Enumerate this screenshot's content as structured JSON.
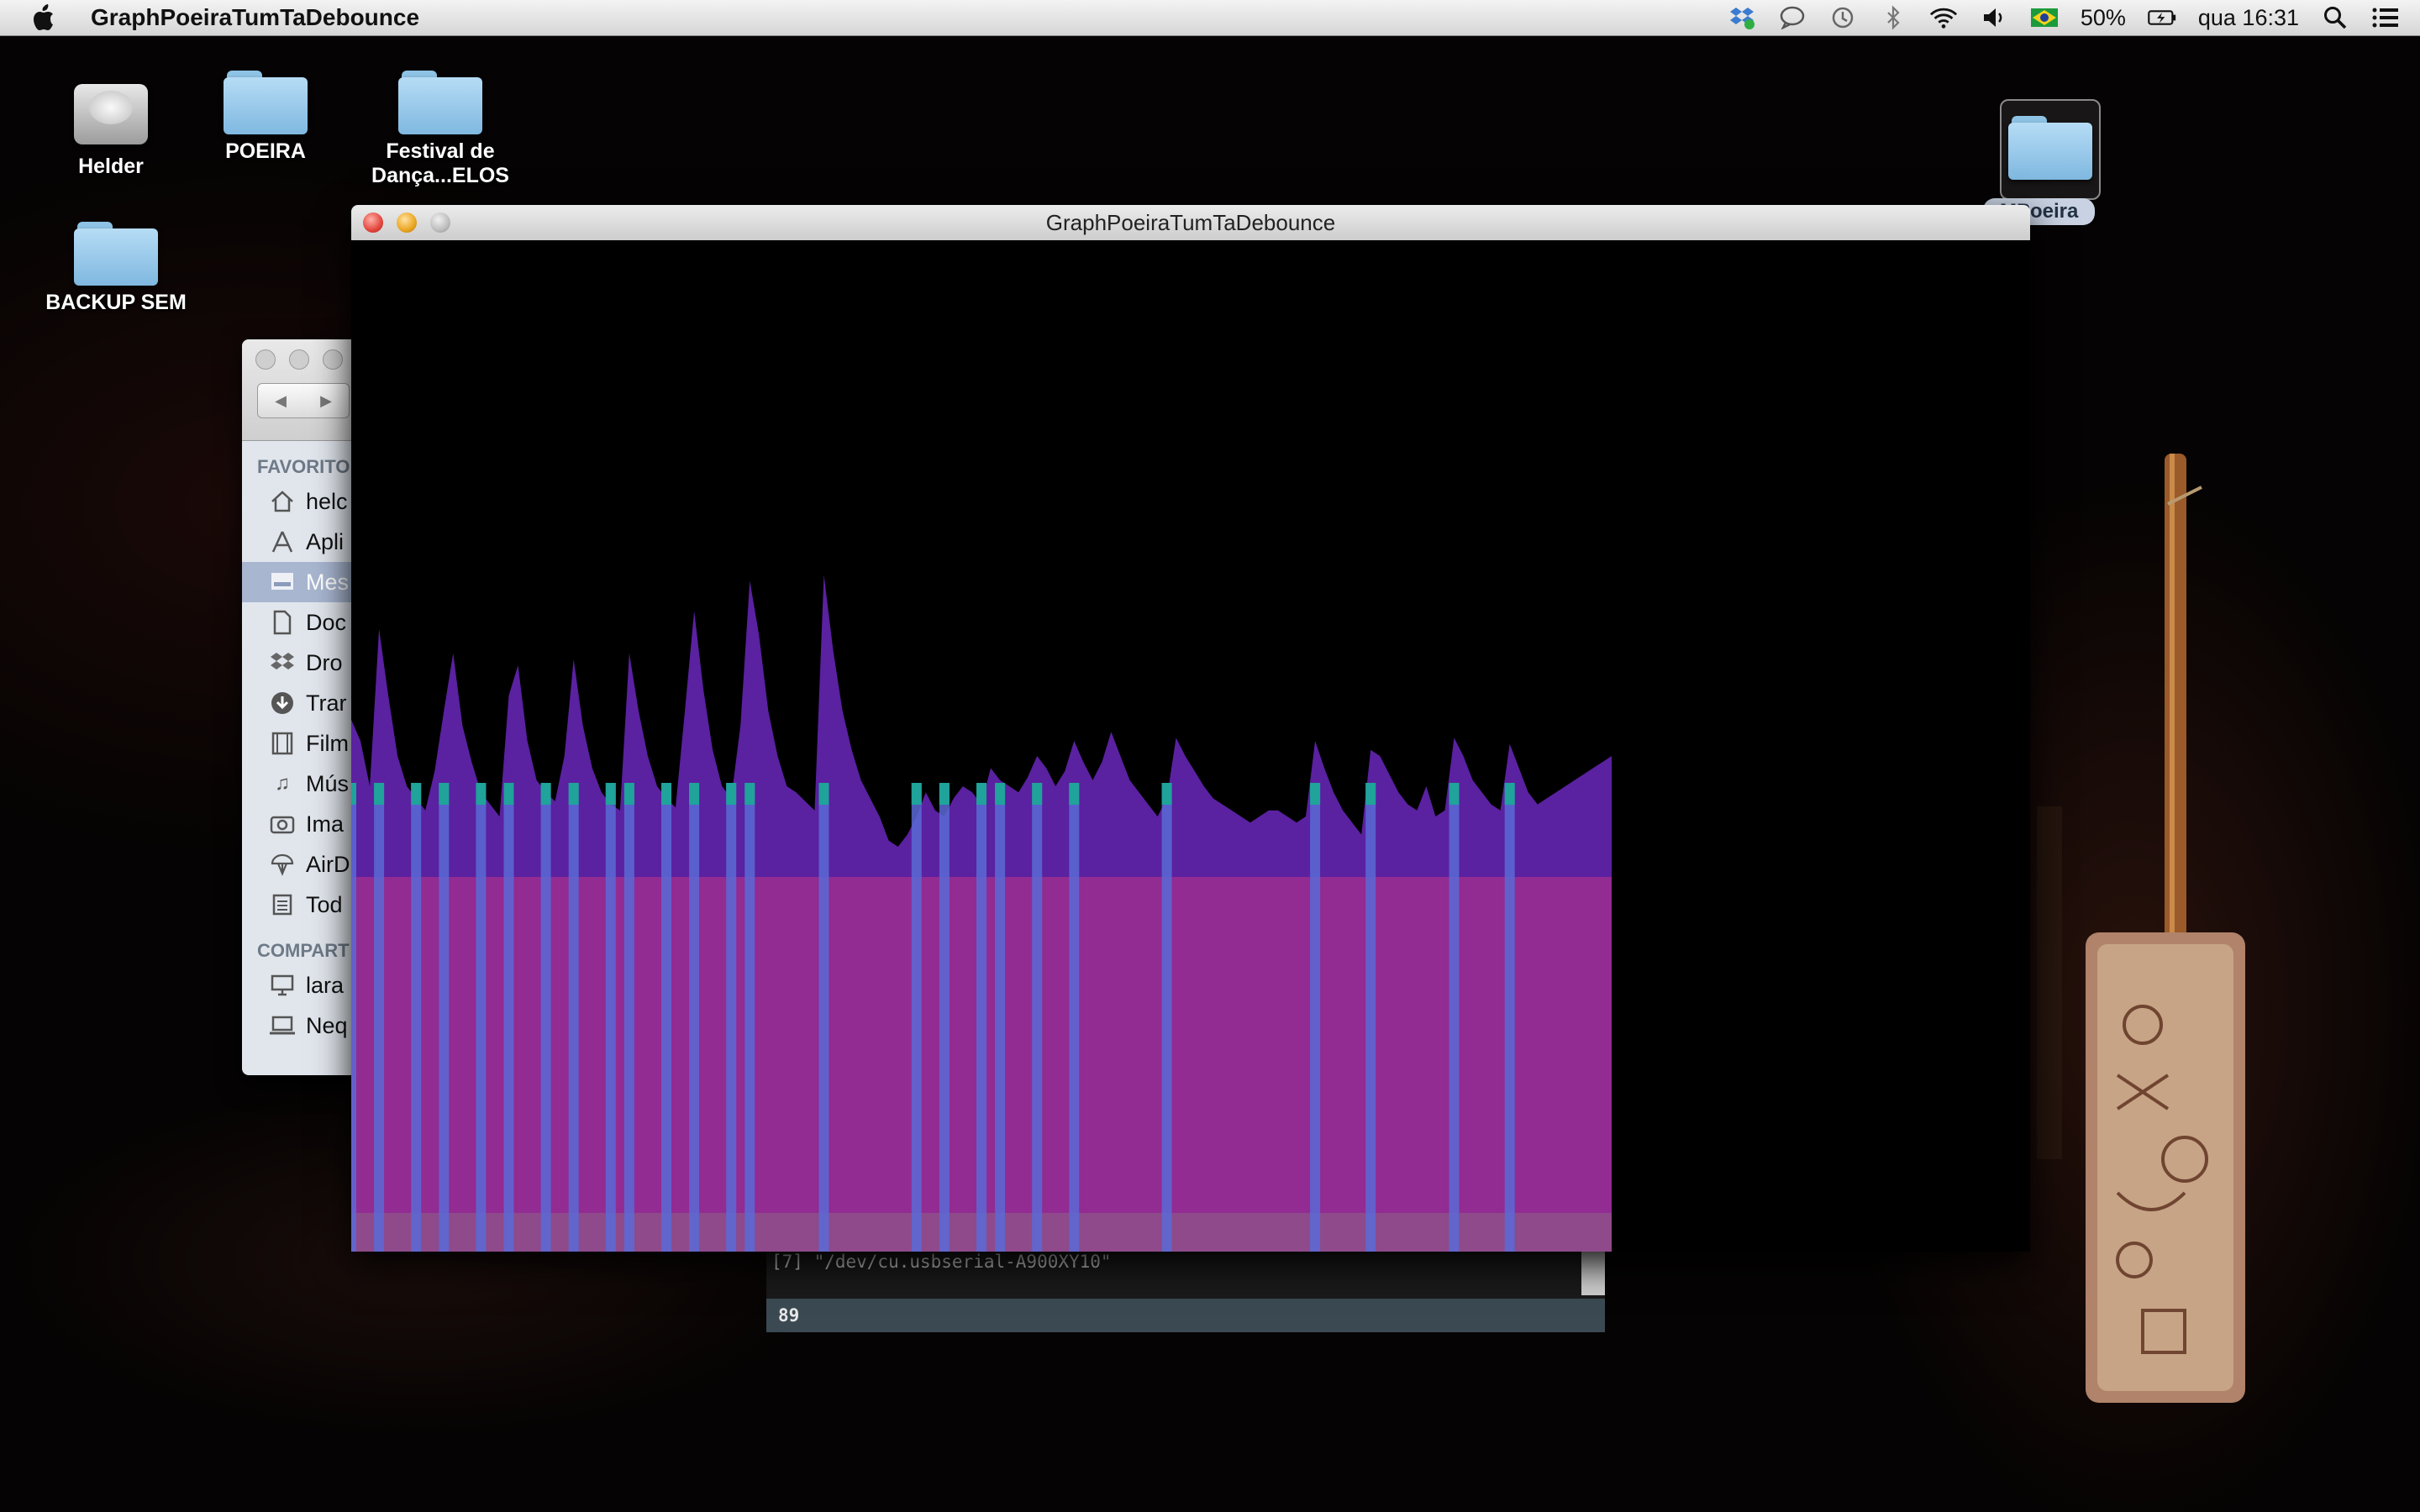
{
  "menubar": {
    "app_name": "GraphPoeiraTumTaDebounce",
    "battery": "50%",
    "clock": "qua 16:31",
    "icons": [
      "dropbox-icon",
      "messages-icon",
      "time-machine-icon",
      "bluetooth-icon",
      "wifi-icon",
      "volume-icon",
      "flag-brazil-icon",
      "battery-icon",
      "spotlight-icon",
      "notification-center-icon"
    ]
  },
  "desktop": {
    "icons": [
      {
        "label": "Helder",
        "type": "hard-drive"
      },
      {
        "label": "POEIRA",
        "type": "folder"
      },
      {
        "label": "Festival de Dança...ELOS",
        "type": "folder"
      },
      {
        "label": "BACKUP SEM",
        "type": "folder"
      },
      {
        "label": "MPoeira",
        "type": "folder"
      }
    ]
  },
  "finder": {
    "favorites_header": "FAVORITO",
    "shared_header": "COMPART",
    "items": [
      {
        "label": "helc",
        "icon": "home-icon"
      },
      {
        "label": "Apli",
        "icon": "applications-icon"
      },
      {
        "label": "Mes",
        "icon": "desktop-icon",
        "selected": true
      },
      {
        "label": "Doc",
        "icon": "documents-icon"
      },
      {
        "label": "Dro",
        "icon": "dropbox-icon"
      },
      {
        "label": "Trar",
        "icon": "downloads-icon"
      },
      {
        "label": "Film",
        "icon": "movies-icon"
      },
      {
        "label": "Mús",
        "icon": "music-icon"
      },
      {
        "label": "Ima",
        "icon": "pictures-icon"
      },
      {
        "label": "AirD",
        "icon": "airdrop-icon"
      },
      {
        "label": "Tod",
        "icon": "all-files-icon"
      }
    ],
    "shared": [
      {
        "label": "lara",
        "icon": "computer-icon"
      },
      {
        "label": "Neq",
        "icon": "laptop-icon"
      }
    ]
  },
  "graph_window": {
    "title": "GraphPoeiraTumTaDebounce"
  },
  "serial": {
    "port_line": "[7] \"/dev/cu.usbserial-A900XY10\"",
    "input_value": "89"
  },
  "colors": {
    "wave": "#5a21a0",
    "band": "#922b92",
    "bottom_band": "#8e4a8a",
    "hit_line": "#5a6ad6",
    "hit_tip": "#1fa39a"
  },
  "chart_data": {
    "type": "area",
    "series": [
      {
        "name": "",
        "values": [
          0.52,
          0.45,
          0.3,
          0.82,
          0.6,
          0.4,
          0.3,
          0.26,
          0.22,
          0.35,
          0.55,
          0.74,
          0.5,
          0.38,
          0.28,
          0.24,
          0.2,
          0.6,
          0.7,
          0.45,
          0.32,
          0.28,
          0.25,
          0.4,
          0.72,
          0.5,
          0.36,
          0.28,
          0.24,
          0.22,
          0.74,
          0.55,
          0.4,
          0.3,
          0.26,
          0.23,
          0.55,
          0.88,
          0.62,
          0.42,
          0.3,
          0.26,
          0.5,
          0.98,
          0.8,
          0.55,
          0.4,
          0.3,
          0.28,
          0.25,
          0.22,
          1.0,
          0.75,
          0.55,
          0.42,
          0.32,
          0.26,
          0.2,
          0.12,
          0.1,
          0.14,
          0.2,
          0.28,
          0.22,
          0.2,
          0.26,
          0.3,
          0.28,
          0.24,
          0.36,
          0.32,
          0.3,
          0.28,
          0.33,
          0.4,
          0.36,
          0.3,
          0.35,
          0.45,
          0.38,
          0.32,
          0.38,
          0.48,
          0.4,
          0.32,
          0.28,
          0.24,
          0.2,
          0.26,
          0.46,
          0.4,
          0.35,
          0.3,
          0.26,
          0.24,
          0.22,
          0.2,
          0.18,
          0.2,
          0.22,
          0.22,
          0.2,
          0.18,
          0.2,
          0.45,
          0.36,
          0.28,
          0.22,
          0.18,
          0.14,
          0.42,
          0.4,
          0.34,
          0.28,
          0.24,
          0.22,
          0.3,
          0.2,
          0.22,
          0.46,
          0.4,
          0.32,
          0.28,
          0.24,
          0.22,
          0.44,
          0.36,
          0.28,
          0.24,
          0.26,
          0.28,
          0.3,
          0.32,
          0.34,
          0.36,
          0.38,
          0.4
        ]
      },
      {
        "name": "",
        "values": [
          1,
          0,
          0,
          1,
          0,
          0,
          0,
          1,
          0,
          0,
          1,
          0,
          0,
          0,
          1,
          0,
          0,
          1,
          0,
          0,
          0,
          1,
          0,
          0,
          1,
          0,
          0,
          0,
          1,
          0,
          1,
          0,
          0,
          0,
          1,
          0,
          0,
          1,
          0,
          0,
          0,
          1,
          0,
          1,
          0,
          0,
          0,
          0,
          0,
          0,
          0,
          1,
          0,
          0,
          0,
          0,
          0,
          0,
          0,
          0,
          0,
          1,
          0,
          0,
          1,
          0,
          0,
          0,
          1,
          0,
          1,
          0,
          0,
          0,
          1,
          0,
          0,
          0,
          1,
          0,
          0,
          0,
          0,
          0,
          0,
          0,
          0,
          0,
          1,
          0,
          0,
          0,
          0,
          0,
          0,
          0,
          0,
          0,
          0,
          0,
          0,
          0,
          0,
          0,
          1,
          0,
          0,
          0,
          0,
          0,
          1,
          0,
          0,
          0,
          0,
          0,
          0,
          0,
          0,
          1,
          0,
          0,
          0,
          0,
          0,
          1,
          0,
          0,
          0,
          0,
          0,
          0,
          0,
          0,
          0,
          0,
          0
        ]
      }
    ]
  }
}
